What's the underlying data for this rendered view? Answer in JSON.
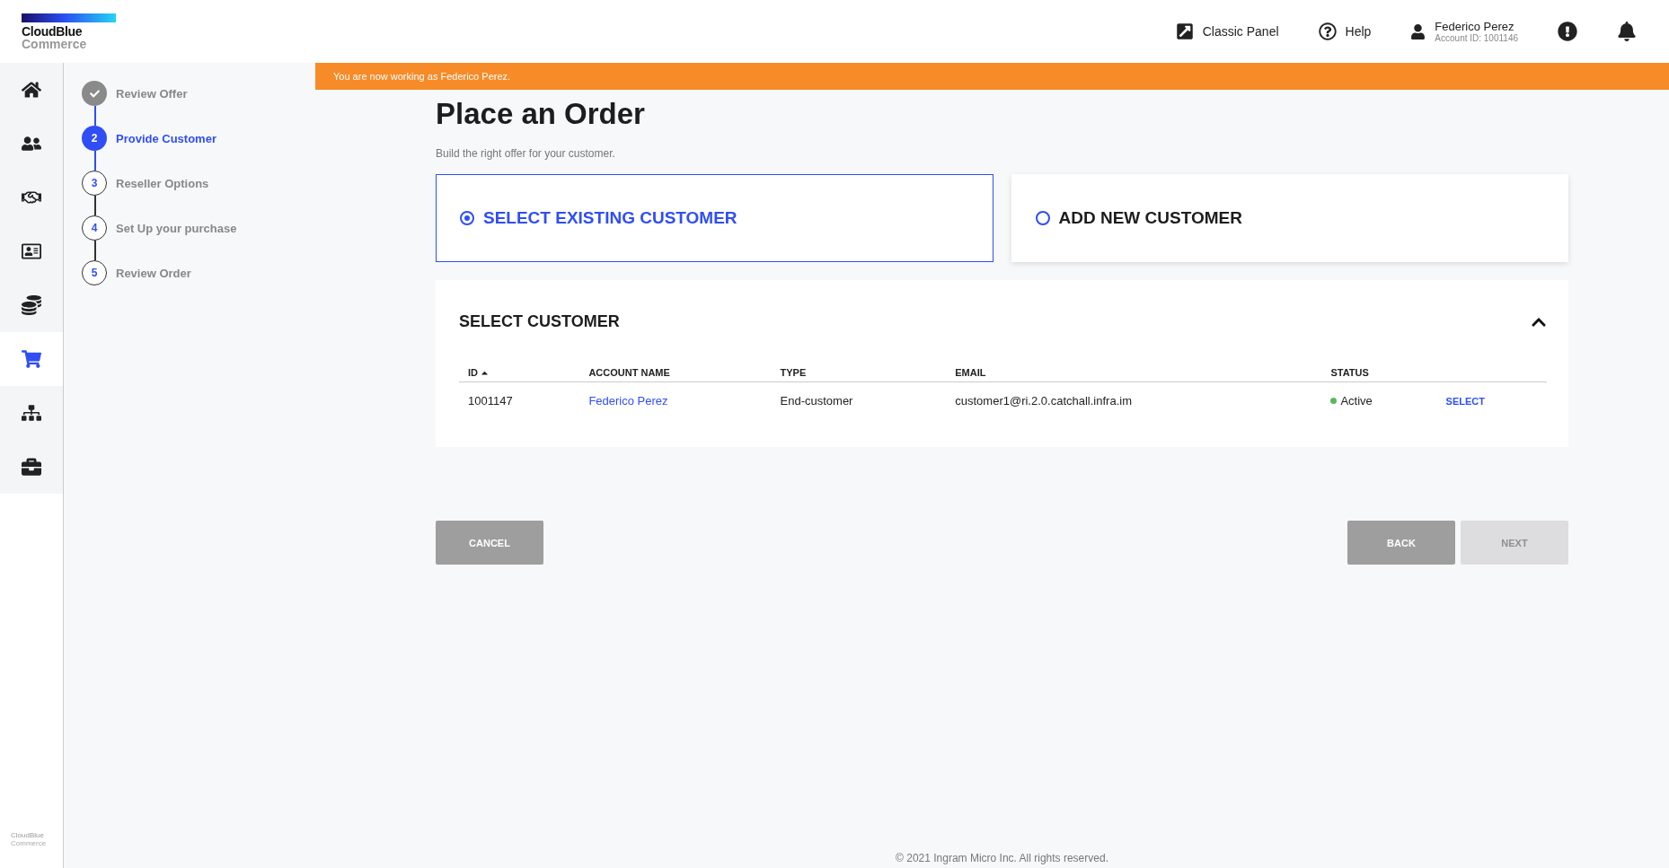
{
  "logo": {
    "line1": "CloudBlue",
    "line2": "Commerce"
  },
  "header_actions": [
    {
      "kind": "link",
      "label": "Classic Panel"
    },
    {
      "kind": "help",
      "label": "Help"
    },
    {
      "kind": "user",
      "label": "Federico Perez",
      "sublabel": "Account ID: 1001146"
    },
    {
      "kind": "alert"
    },
    {
      "kind": "bell"
    }
  ],
  "nav": [
    {
      "kind": "home",
      "selected": false
    },
    {
      "kind": "users",
      "selected": false
    },
    {
      "kind": "handshake",
      "selected": false
    },
    {
      "kind": "card",
      "selected": false
    },
    {
      "kind": "coins",
      "selected": false
    },
    {
      "kind": "cart",
      "selected": true
    },
    {
      "kind": "sitemap",
      "selected": false
    },
    {
      "kind": "briefcase",
      "selected": false
    }
  ],
  "sidebar_footer": {
    "line1": "CloudBlue",
    "line2": "Commerce"
  },
  "steps": [
    {
      "label": "Review Offer",
      "completed": true,
      "selected": false
    },
    {
      "number": "2",
      "label": "Provide Customer",
      "completed": false,
      "selected": true
    },
    {
      "number": "3",
      "label": "Reseller Options",
      "completed": false,
      "selected": false
    },
    {
      "number": "4",
      "label": "Set Up your purchase",
      "completed": false,
      "selected": false
    },
    {
      "number": "5",
      "label": "Review Order",
      "completed": false,
      "selected": false
    }
  ],
  "banner": "You are now working as Federico Perez.",
  "title": "Place an Order",
  "subtitle": "Build the right offer for your customer.",
  "options": [
    {
      "label": "SELECT EXISTING CUSTOMER",
      "selected": true
    },
    {
      "label": "ADD NEW CUSTOMER",
      "selected": false
    }
  ],
  "panel": {
    "title": "SELECT CUSTOMER",
    "expanded": true,
    "columns": [
      {
        "label": "ID",
        "sorted": true
      },
      {
        "label": "ACCOUNT NAME",
        "sorted": false
      },
      {
        "label": "TYPE",
        "sorted": false
      },
      {
        "label": "EMAIL",
        "sorted": false
      },
      {
        "label": "STATUS",
        "sorted": false
      }
    ],
    "rows": [
      {
        "id": "1001147",
        "name": "Federico Perez",
        "type": "End-customer",
        "email": "customer1@ri.2.0.catchall.infra.im",
        "status": "Active",
        "color": "#5cb85c",
        "action": "SELECT"
      }
    ]
  },
  "buttons": [
    {
      "kind": "cancel",
      "label": "CANCEL",
      "disabled": false
    },
    {
      "kind": "back",
      "label": "BACK",
      "disabled": false
    },
    {
      "kind": "next",
      "label": "NEXT",
      "disabled": true
    }
  ],
  "footer": "© 2021 Ingram Micro Inc. All rights reserved."
}
